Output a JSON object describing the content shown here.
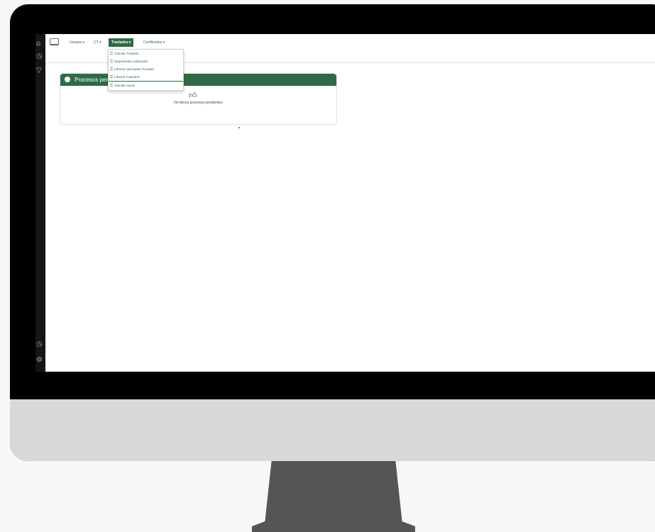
{
  "nav": {
    "usuario": "Usuario ▾",
    "ct": "CT ▾",
    "traslados": "Traslados ▾",
    "certificados": "Certificados ▾"
  },
  "dropdown": {
    "items": [
      {
        "label": "Solicitar Traslado"
      },
      {
        "label": "Seguimiento solicitudes"
      },
      {
        "label": "Informe solicitudes Traslado"
      },
      {
        "label": "Informe Traslados"
      },
      {
        "label": "Solicitar sacas"
      }
    ]
  },
  "panel": {
    "title": "Procesos pen",
    "empty_message": "No tienes procesos pendientes"
  },
  "colors": {
    "accent": "#2e6b45",
    "dot": "#e02020"
  },
  "icons": {
    "brand": "monitor-icon",
    "info": "info-icon",
    "thumb": "thumbs-up-icon",
    "list": "list-icon"
  }
}
